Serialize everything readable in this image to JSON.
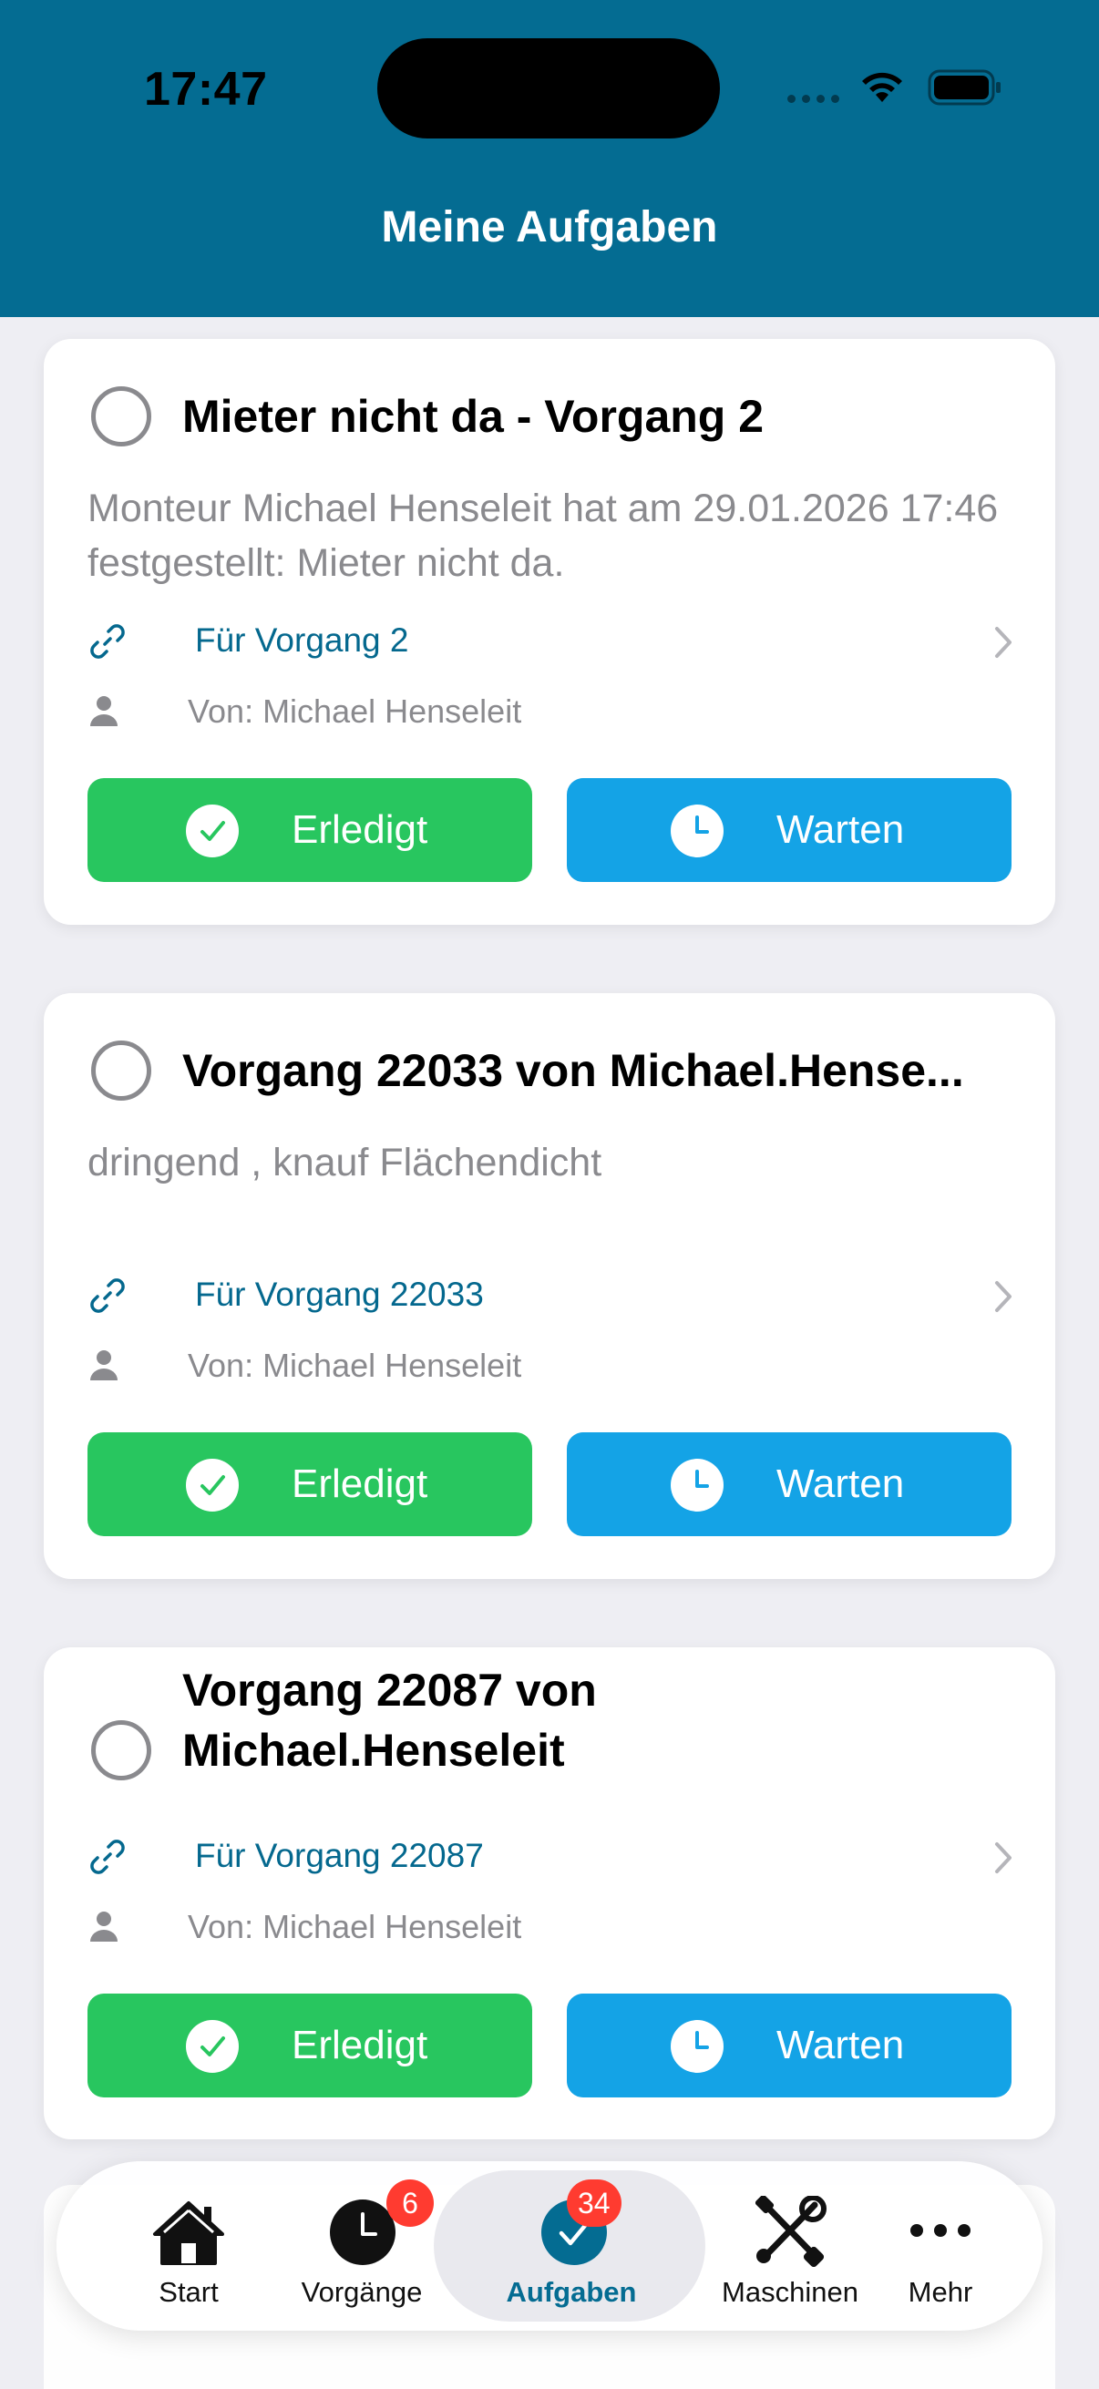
{
  "status_bar": {
    "time": "17:47"
  },
  "header": {
    "title": "Meine Aufgaben"
  },
  "tasks": [
    {
      "title": "Mieter nicht da - Vorgang 2",
      "description": "Monteur Michael Henseleit hat am 29.01.2026 17:46 festgestellt: Mieter nicht da.",
      "link": "Für Vorgang 2",
      "from": "Von: Michael Henseleit",
      "done_label": "Erledigt",
      "wait_label": "Warten"
    },
    {
      "title": "Vorgang 22033 von Michael.Hense...",
      "description": "dringend , knauf Flächendicht",
      "link": "Für Vorgang 22033",
      "from": "Von: Michael Henseleit",
      "done_label": "Erledigt",
      "wait_label": "Warten"
    },
    {
      "title": "Vorgang 22087 von Michael.Henseleit",
      "description": "",
      "link": "Für Vorgang 22087",
      "from": "Von: Michael Henseleit",
      "done_label": "Erledigt",
      "wait_label": "Warten"
    }
  ],
  "tabbar": {
    "items": [
      {
        "label": "Start",
        "icon": "house-icon",
        "badge": ""
      },
      {
        "label": "Vorgänge",
        "icon": "clock-icon",
        "badge": "6"
      },
      {
        "label": "Aufgaben",
        "icon": "checkmark-circle-icon",
        "badge": "34",
        "active": true
      },
      {
        "label": "Maschinen",
        "icon": "tools-icon",
        "badge": ""
      },
      {
        "label": "Mehr",
        "icon": "more-dots-icon",
        "badge": ""
      }
    ]
  },
  "colors": {
    "header": "#046c92",
    "done": "#28c65f",
    "wait": "#14a3e6",
    "link": "#04688e",
    "badge": "#ff3b30"
  }
}
